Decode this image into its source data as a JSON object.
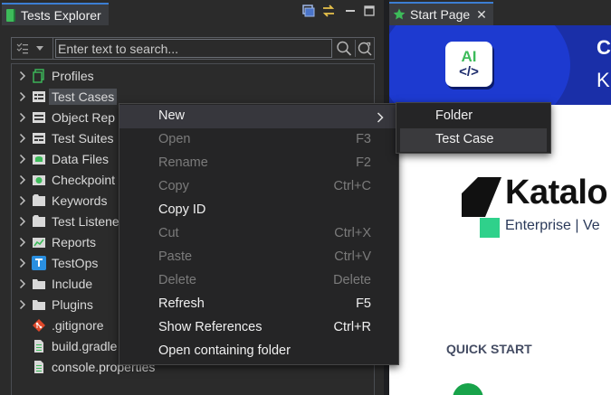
{
  "left_panel": {
    "tab_title": "Tests Explorer",
    "search_placeholder": "Enter text to search...",
    "tree": [
      {
        "label": "Profiles",
        "icon": "profiles-icon"
      },
      {
        "label": "Test Cases",
        "icon": "test-cases-icon",
        "selected": true
      },
      {
        "label": "Object Rep",
        "icon": "object-repository-icon"
      },
      {
        "label": "Test Suites",
        "icon": "test-suites-icon"
      },
      {
        "label": "Data Files",
        "icon": "data-files-icon"
      },
      {
        "label": "Checkpoint",
        "icon": "checkpoints-icon"
      },
      {
        "label": "Keywords",
        "icon": "keywords-icon"
      },
      {
        "label": "Test Listene",
        "icon": "test-listeners-icon"
      },
      {
        "label": "Reports",
        "icon": "reports-icon"
      },
      {
        "label": "TestOps",
        "icon": "testops-icon"
      },
      {
        "label": "Include",
        "icon": "include-icon"
      },
      {
        "label": "Plugins",
        "icon": "plugins-icon"
      },
      {
        "label": ".gitignore",
        "icon": "git-icon"
      },
      {
        "label": "build.gradle",
        "icon": "file-icon"
      },
      {
        "label": "console.properties",
        "icon": "file-icon"
      }
    ]
  },
  "context_menu": {
    "items": [
      {
        "label": "New",
        "shortcut": "",
        "disabled": false,
        "submenu": true
      },
      {
        "label": "Open",
        "shortcut": "F3",
        "disabled": true
      },
      {
        "label": "Rename",
        "shortcut": "F2",
        "disabled": true
      },
      {
        "label": "Copy",
        "shortcut": "Ctrl+C",
        "disabled": true
      },
      {
        "label": "Copy ID",
        "shortcut": "",
        "disabled": false
      },
      {
        "label": "Cut",
        "shortcut": "Ctrl+X",
        "disabled": true
      },
      {
        "label": "Paste",
        "shortcut": "Ctrl+V",
        "disabled": true
      },
      {
        "label": "Delete",
        "shortcut": "Delete",
        "disabled": true
      },
      {
        "label": "Refresh",
        "shortcut": "F5",
        "disabled": false
      },
      {
        "label": "Show References",
        "shortcut": "Ctrl+R",
        "disabled": false
      },
      {
        "label": "Open containing folder",
        "shortcut": "",
        "disabled": false
      }
    ]
  },
  "submenu": {
    "items": [
      {
        "label": "Folder"
      },
      {
        "label": "Test Case",
        "hover": true
      }
    ]
  },
  "right_panel": {
    "tab_title": "Start Page",
    "banner": {
      "badge_top": "AI",
      "badge_bottom": "</>",
      "text_1": "C",
      "text_2": "K"
    },
    "brand_name": "Katalo",
    "edition": "Enterprise | Ve",
    "quick_start": "QUICK START"
  },
  "colors": {
    "accent": "#3c7ed3",
    "brand_green": "#2fd18b",
    "banner_blue": "#1a2fa8"
  }
}
